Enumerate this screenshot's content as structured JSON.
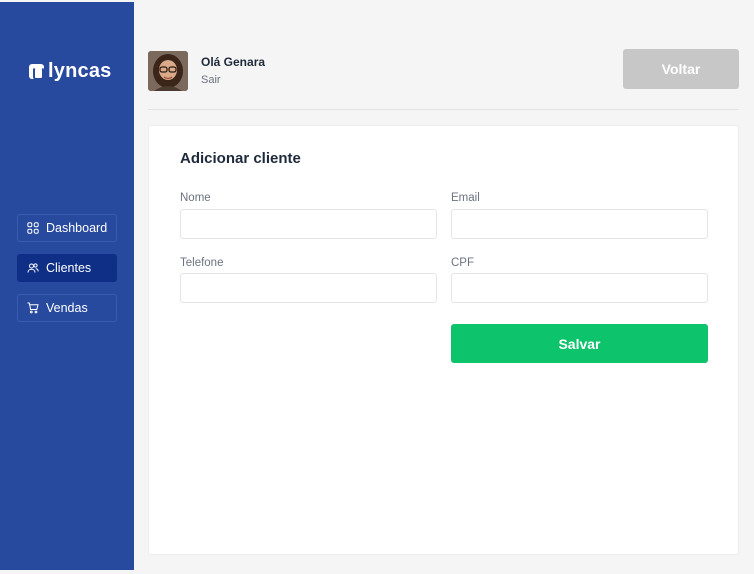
{
  "app": {
    "logo_text": "lyncas",
    "brand_color": "#27499e",
    "accent_color": "#0dc36b"
  },
  "sidebar": {
    "items": [
      {
        "label": "Dashboard",
        "icon": "grid-icon",
        "active": false
      },
      {
        "label": "Clientes",
        "icon": "users-icon",
        "active": true
      },
      {
        "label": "Vendas",
        "icon": "cart-icon",
        "active": false
      }
    ]
  },
  "header": {
    "greeting": "Olá Genara",
    "logout_label": "Sair",
    "back_label": "Voltar"
  },
  "form": {
    "title": "Adicionar cliente",
    "fields": [
      {
        "label": "Nome",
        "value": "",
        "placeholder": ""
      },
      {
        "label": "Email",
        "value": "",
        "placeholder": ""
      },
      {
        "label": "Telefone",
        "value": "",
        "placeholder": ""
      },
      {
        "label": "CPF",
        "value": "",
        "placeholder": ""
      }
    ],
    "save_label": "Salvar"
  }
}
